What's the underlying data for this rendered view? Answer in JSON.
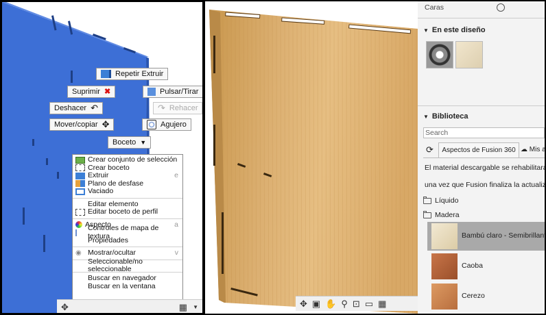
{
  "left": {
    "buttons": {
      "repetir_extruir": "Repetir Extruir",
      "suprimir": "Suprimir",
      "pulsar_tirar": "Pulsar/Tirar",
      "deshacer": "Deshacer",
      "rehacer": "Rehacer",
      "mover_copiar": "Mover/copiar",
      "agujero": "Agujero",
      "boceto": "Boceto"
    },
    "context_menu": {
      "crear_conjunto": "Crear conjunto de selección",
      "crear_boceto": "Crear boceto",
      "extruir": "Extruir",
      "extruir_shortcut": "e",
      "plano_desfase": "Plano de desfase",
      "vaciado": "Vaciado",
      "editar_elemento": "Editar elemento",
      "editar_boceto_perfil": "Editar boceto de perfil",
      "aspecto": "Aspecto",
      "aspecto_shortcut": "a",
      "controles_mapa": "Controles de mapa de textura",
      "propiedades": "Propiedades",
      "mostrar_ocultar": "Mostrar/ocultar",
      "mostrar_shortcut": "v",
      "seleccionable": "Seleccionable/no seleccionable",
      "buscar_navegador": "Buscar en navegador",
      "buscar_ventana": "Buscar en la ventana"
    },
    "colors": {
      "body_blue": "#3d6fd6",
      "edge_blue": "#2a55b0"
    }
  },
  "right": {
    "caras_label": "Caras",
    "en_este_diseno": "En este diseño",
    "biblioteca": "Biblioteca",
    "search_placeholder": "Search",
    "tab_fusion": "Aspectos de Fusion 360",
    "tab_mis": "Mis a",
    "notice_line1": "El material descargable se rehabilitará",
    "notice_line2": "una vez que Fusion finaliza la actualización",
    "folder_liquido": "Líquido",
    "folder_madera": "Madera",
    "materials": [
      {
        "name": "Bambú claro - Semibrillante",
        "color": "#e7dcc2",
        "selected": true
      },
      {
        "name": "Caoba",
        "color": "#b8643a",
        "selected": false
      },
      {
        "name": "Cerezo",
        "color": "#cf8a55",
        "selected": false
      }
    ]
  }
}
